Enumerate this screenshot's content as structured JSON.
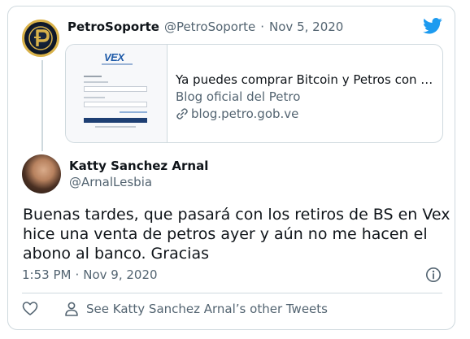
{
  "parent_tweet": {
    "author_name": "PetroSoporte",
    "author_handle": "@PetroSoporte",
    "separator": "·",
    "date": "Nov 5, 2020",
    "link_card": {
      "thumbnail_logo_text": "VEX",
      "title": "Ya puedes comprar Bitcoin y Petros con tus Bo…",
      "description": "Blog oficial del Petro",
      "domain": "blog.petro.gob.ve"
    }
  },
  "main_tweet": {
    "author_name": "Katty Sanchez Arnal",
    "author_handle": "@ArnalLesbia",
    "text": "Buenas tardes, que pasará con los retiros de BS en Vex  hice una venta de petros ayer y aún no me hacen el abono al banco. Gracias",
    "time": "1:53 PM",
    "separator": "·",
    "date": "Nov 9, 2020"
  },
  "actions": {
    "other_tweets_label": "See Katty Sanchez Arnal’s other Tweets"
  },
  "colors": {
    "twitter_blue": "#1d9bf0",
    "secondary_text": "#536471",
    "border": "#cfd9de",
    "petro_gold": "#d9b24a"
  },
  "icons": [
    "petro-logo-icon",
    "twitter-bird-icon",
    "link-icon",
    "info-icon",
    "heart-icon",
    "person-icon"
  ]
}
